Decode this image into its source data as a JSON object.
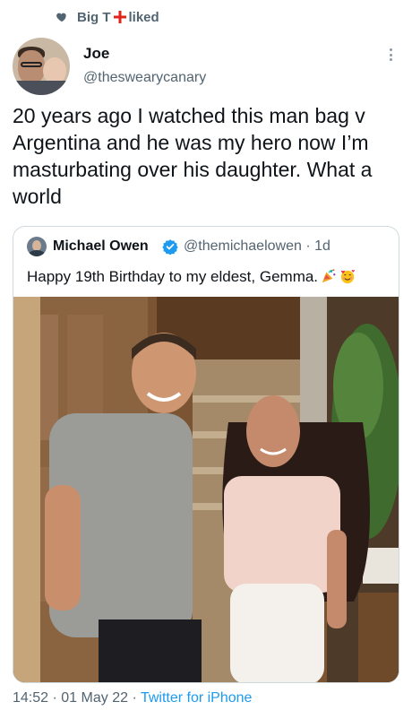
{
  "social_context": {
    "label_before": "Big T",
    "label_after": "liked",
    "flag_icon": "england-flag-icon",
    "heart_icon": "heart-icon"
  },
  "tweet": {
    "author_name": "Joe",
    "author_handle": "@theswearycanary",
    "text": "20 years ago I watched this man bag v Argentina and he was my hero now I’m masturbating over his daughter. What a world",
    "time": "14:52",
    "date": "01 May 22",
    "source": "Twitter for iPhone",
    "separator": "·"
  },
  "quoted_tweet": {
    "author_name": "Michael Owen",
    "verified": true,
    "author_handle": "@themichaelowen",
    "age": "1d",
    "text": "Happy 19th Birthday to my eldest, Gemma.",
    "emojis": [
      "party-popper-icon",
      "smiling-face-with-hearts-icon"
    ]
  },
  "colors": {
    "link_blue": "#1d9bf0",
    "secondary_text": "#536471",
    "border": "#cfd9de",
    "flag_red": "#e2231a"
  }
}
